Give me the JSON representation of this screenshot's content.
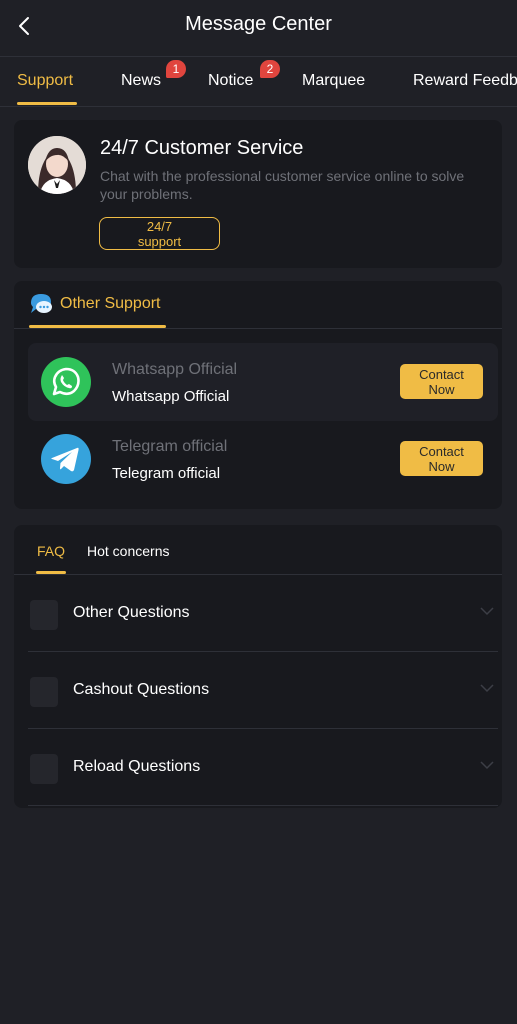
{
  "header": {
    "title": "Message Center"
  },
  "tabs": [
    {
      "label": "Support",
      "active": true
    },
    {
      "label": "News",
      "badge": "1"
    },
    {
      "label": "Notice",
      "badge": "2"
    },
    {
      "label": "Marquee"
    },
    {
      "label": "Reward Feedb"
    }
  ],
  "customer_service": {
    "title": "24/7 Customer Service",
    "description": "Chat with the professional customer service online to solve your problems.",
    "button_line1": "24/7",
    "button_line2": "support"
  },
  "other_support": {
    "label": "Other Support",
    "contacts": [
      {
        "title": "Whatsapp Official",
        "subtitle": "Whatsapp Official",
        "button_line1": "Contact",
        "button_line2": "Now",
        "icon": "whatsapp-icon"
      },
      {
        "title": "Telegram official",
        "subtitle": "Telegram official",
        "button_line1": "Contact",
        "button_line2": "Now",
        "icon": "telegram-icon"
      }
    ]
  },
  "faq": {
    "tabs": [
      {
        "label": "FAQ",
        "active": true
      },
      {
        "label": "Hot concerns"
      }
    ],
    "items": [
      {
        "label": "Other Questions"
      },
      {
        "label": "Cashout Questions"
      },
      {
        "label": "Reload Questions"
      }
    ]
  },
  "colors": {
    "accent": "#f0bc45",
    "background": "#1f2026",
    "card": "#18191e",
    "badge": "#e0453e"
  }
}
